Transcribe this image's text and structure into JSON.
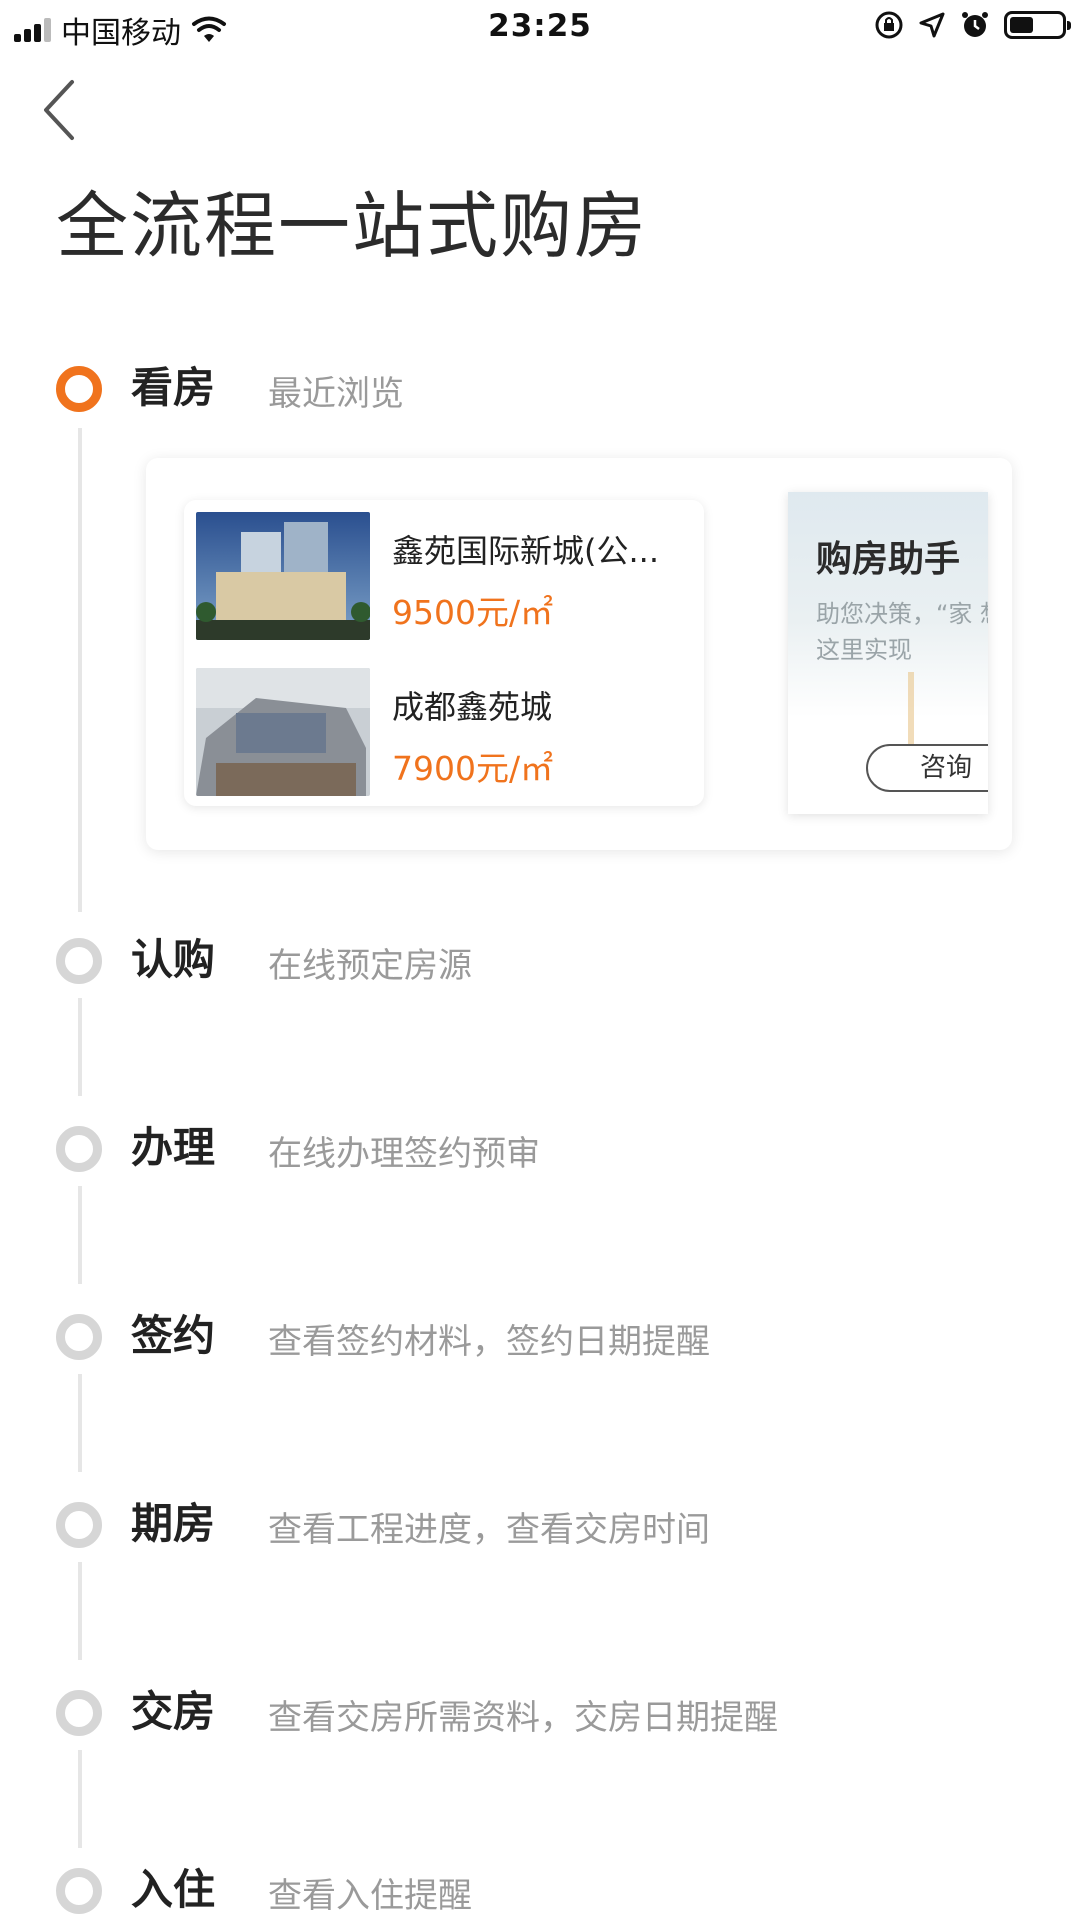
{
  "status_bar": {
    "carrier": "中国移动",
    "time": "23:25",
    "battery_percent": 45
  },
  "page": {
    "title": "全流程一站式购房"
  },
  "steps": [
    {
      "label": "看房",
      "desc": "最近浏览",
      "active": true
    },
    {
      "label": "认购",
      "desc": "在线预定房源",
      "active": false
    },
    {
      "label": "办理",
      "desc": "在线办理签约预审",
      "active": false
    },
    {
      "label": "签约",
      "desc": "查看签约材料，签约日期提醒",
      "active": false
    },
    {
      "label": "期房",
      "desc": "查看工程进度，查看交房时间",
      "active": false
    },
    {
      "label": "交房",
      "desc": "查看交房所需资料，交房日期提醒",
      "active": false
    },
    {
      "label": "入住",
      "desc": "查看入住提醒",
      "active": false
    }
  ],
  "recent_houses": [
    {
      "name": "鑫苑国际新城(公...",
      "price": "9500元/㎡"
    },
    {
      "name": "成都鑫苑城",
      "price": "7900元/㎡"
    }
  ],
  "assistant": {
    "title": "购房助手",
    "desc": "助您决策，“家 想就在这里实现",
    "consult_label": "咨询"
  },
  "colors": {
    "accent": "#f0731d",
    "inactive_dot": "#d6d6d6",
    "timeline": "#e6e6e6"
  }
}
